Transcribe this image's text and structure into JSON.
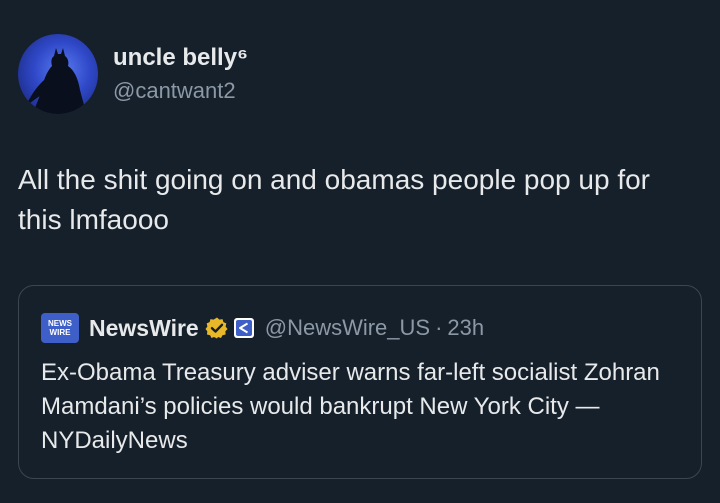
{
  "author": {
    "display_name": "uncle belly⁶",
    "handle": "@cantwant2",
    "avatar_icon": "batman-silhouette-icon"
  },
  "tweet": {
    "text": "All the shit going on and obamas people pop up for this lmfaooo"
  },
  "quoted_tweet": {
    "logo_line1": "NEWS",
    "logo_line2": "WIRE",
    "display_name": "NewsWire",
    "verified_badge_icon": "gold-verified-badge-icon",
    "affiliate_icon": "affiliate-badge-icon",
    "handle": "@NewsWire_US",
    "separator": "·",
    "time": "23h",
    "text": "Ex-Obama Treasury adviser warns far-left socialist Zohran Mamdani’s policies would bankrupt New York City — NYDailyNews"
  },
  "colors": {
    "background": "#16202b",
    "text_primary": "#e7e9ea",
    "text_secondary": "#8b98a5",
    "border": "#3a4652",
    "verified_gold": "#e8b829",
    "affiliate_blue": "#3f5fc8"
  }
}
